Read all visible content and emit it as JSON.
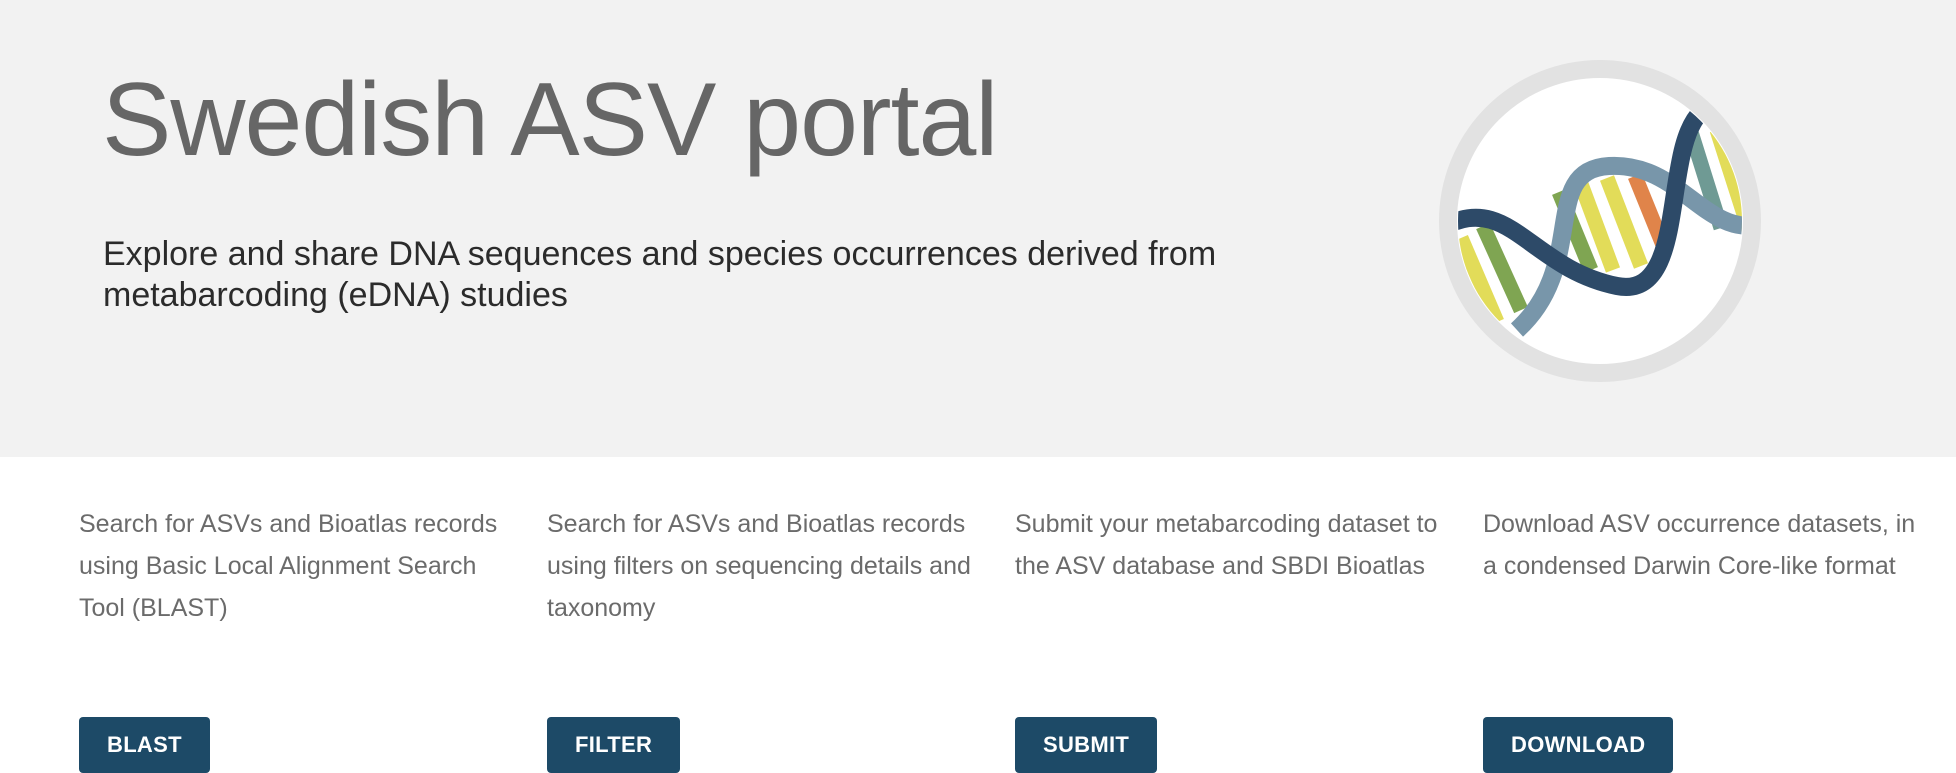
{
  "hero": {
    "title": "Swedish ASV portal",
    "subtitle": "Explore and share DNA sequences and species occurrences derived from metabarcoding (eDNA) studies",
    "logo_icon": "dna-helix-icon"
  },
  "features": [
    {
      "description": "Search for ASVs and Bioatlas records using Basic Local Alignment Search Tool (BLAST)",
      "button_label": "BLAST"
    },
    {
      "description": "Search for ASVs and Bioatlas records using filters on sequencing details and taxonomy",
      "button_label": "FILTER"
    },
    {
      "description": "Submit your metabarcoding dataset to the ASV database and SBDI Bioatlas",
      "button_label": "SUBMIT"
    },
    {
      "description": "Download ASV occurrence datasets, in a condensed Darwin Core-like format",
      "button_label": "DOWNLOAD"
    }
  ],
  "colors": {
    "hero_background": "#f2f2f2",
    "button_background": "#1d4a67",
    "title_text": "#666666",
    "body_text": "#6b6b6b",
    "strand_dark": "#2d4a68",
    "strand_light": "#7896aa",
    "base_green": "#7fa552",
    "base_yellow": "#e2dc59",
    "base_orange": "#e0844a",
    "base_teal": "#6f9a94"
  }
}
